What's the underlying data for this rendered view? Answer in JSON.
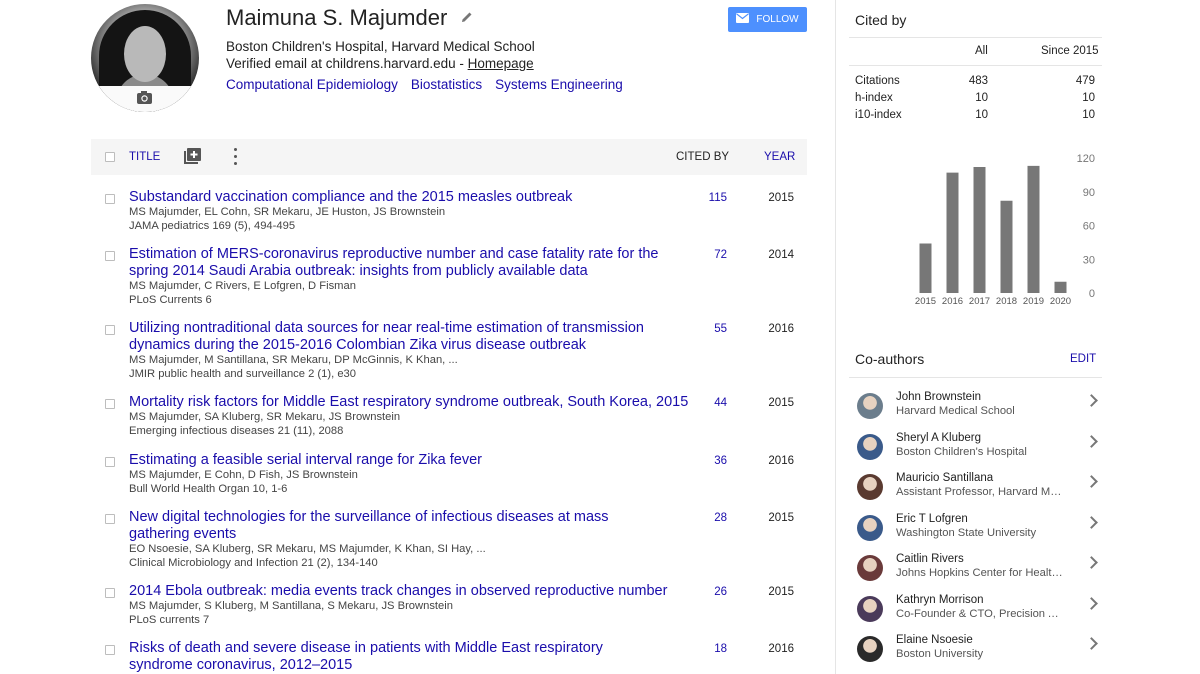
{
  "profile": {
    "name": "Maimuna S. Majumder",
    "affiliation": "Boston Children's Hospital, Harvard Medical School",
    "email_text": "Verified email at childrens.harvard.edu - ",
    "homepage_label": "Homepage",
    "interests": [
      "Computational Epidemiology",
      "Biostatistics",
      "Systems Engineering"
    ],
    "follow_label": "FOLLOW"
  },
  "table": {
    "title_label": "TITLE",
    "cited_by_label": "CITED BY",
    "year_label": "YEAR"
  },
  "articles": [
    {
      "title": "Substandard vaccination compliance and the 2015 measles outbreak",
      "authors": "MS Majumder, EL Cohn, SR Mekaru, JE Huston, JS Brownstein",
      "venue": "JAMA pediatrics 169 (5), 494-495",
      "cited": "115",
      "year": "2015"
    },
    {
      "title": "Estimation of MERS-coronavirus reproductive number and case fatality rate for the spring 2014 Saudi Arabia outbreak: insights from publicly available data",
      "authors": "MS Majumder, C Rivers, E Lofgren, D Fisman",
      "venue": "PLoS Currents 6",
      "cited": "72",
      "year": "2014"
    },
    {
      "title": "Utilizing nontraditional data sources for near real-time estimation of transmission dynamics during the 2015-2016 Colombian Zika virus disease outbreak",
      "authors": "MS Majumder, M Santillana, SR Mekaru, DP McGinnis, K Khan, ...",
      "venue": "JMIR public health and surveillance 2 (1), e30",
      "cited": "55",
      "year": "2016"
    },
    {
      "title": "Mortality risk factors for Middle East respiratory syndrome outbreak, South Korea, 2015",
      "authors": "MS Majumder, SA Kluberg, SR Mekaru, JS Brownstein",
      "venue": "Emerging infectious diseases 21 (11), 2088",
      "cited": "44",
      "year": "2015"
    },
    {
      "title": "Estimating a feasible serial interval range for Zika fever",
      "authors": "MS Majumder, E Cohn, D Fish, JS Brownstein",
      "venue": "Bull World Health Organ 10, 1-6",
      "cited": "36",
      "year": "2016"
    },
    {
      "title": "New digital technologies for the surveillance of infectious diseases at mass gathering events",
      "authors": "EO Nsoesie, SA Kluberg, SR Mekaru, MS Majumder, K Khan, SI Hay, ...",
      "venue": "Clinical Microbiology and Infection 21 (2), 134-140",
      "cited": "28",
      "year": "2015"
    },
    {
      "title": "2014 Ebola outbreak: media events track changes in observed reproductive number",
      "authors": "MS Majumder, S Kluberg, M Santillana, S Mekaru, JS Brownstein",
      "venue": "PLoS currents 7",
      "cited": "26",
      "year": "2015"
    },
    {
      "title": "Risks of death and severe disease in patients with Middle East respiratory syndrome coronavirus, 2012–2015",
      "authors": "",
      "venue": "",
      "cited": "18",
      "year": "2016"
    }
  ],
  "cited_by": {
    "heading": "Cited by",
    "col_all": "All",
    "col_since": "Since 2015",
    "rows": [
      {
        "label": "Citations",
        "all": "483",
        "since": "479"
      },
      {
        "label": "h-index",
        "all": "10",
        "since": "10"
      },
      {
        "label": "i10-index",
        "all": "10",
        "since": "10"
      }
    ]
  },
  "chart_data": {
    "type": "bar",
    "categories": [
      "2015",
      "2016",
      "2017",
      "2018",
      "2019",
      "2020"
    ],
    "values": [
      44,
      107,
      112,
      82,
      113,
      10
    ],
    "ylim": [
      0,
      120
    ],
    "yticks": [
      "120",
      "90",
      "60",
      "30",
      "0"
    ],
    "bar_color": "#777777",
    "grid": false
  },
  "coauthors": {
    "heading": "Co-authors",
    "edit_label": "EDIT",
    "items": [
      {
        "name": "John Brownstein",
        "affiliation": "Harvard Medical School"
      },
      {
        "name": "Sheryl A Kluberg",
        "affiliation": "Boston Children's Hospital"
      },
      {
        "name": "Mauricio Santillana",
        "affiliation": "Assistant Professor, Harvard Me…"
      },
      {
        "name": "Eric T Lofgren",
        "affiliation": "Washington State University"
      },
      {
        "name": "Caitlin Rivers",
        "affiliation": "Johns Hopkins Center for Health…"
      },
      {
        "name": "Kathryn Morrison",
        "affiliation": "Co-Founder & CTO, Precision A…"
      },
      {
        "name": "Elaine Nsoesie",
        "affiliation": "Boston University"
      }
    ]
  },
  "icons": {
    "edit": "pencil-icon",
    "follow": "mail-icon",
    "camera": "camera-icon",
    "add_to_library": "playlist-add-icon",
    "more": "more-vert-icon",
    "chevron": "chevron-right-icon"
  }
}
